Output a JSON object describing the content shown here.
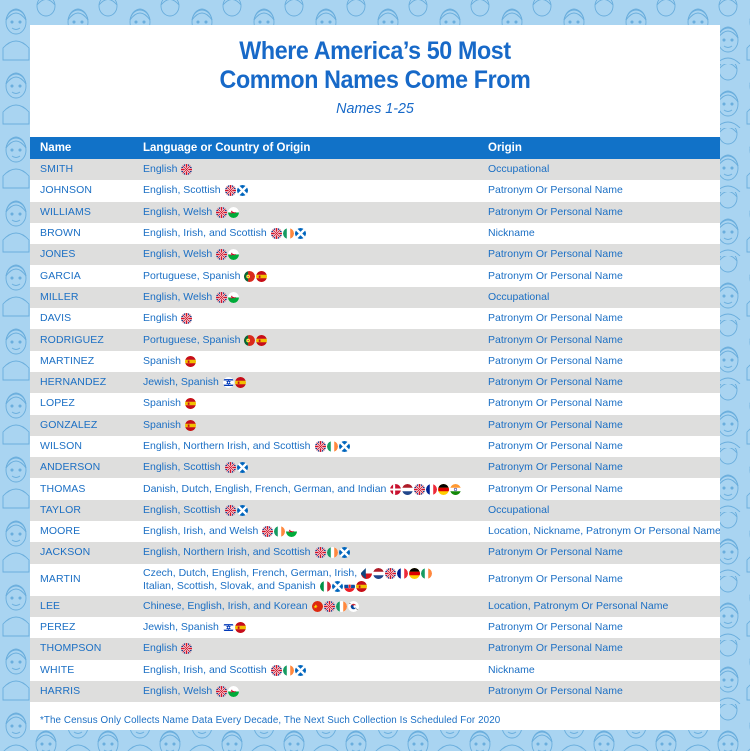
{
  "colors": {
    "brand_blue": "#1769c8",
    "header_blue": "#1172c8",
    "text_blue": "#1b6fc4",
    "row_alt": "#dededd",
    "background": "#a9d4f1",
    "card": "#ffffff"
  },
  "header": {
    "title_line_1": "Where America’s 50 Most",
    "title_line_2": "Common Names Come From",
    "subtitle": "Names 1-25"
  },
  "table": {
    "columns": [
      "Name",
      "Language or Country of Origin",
      "Origin"
    ],
    "rows": [
      {
        "name": "SMITH",
        "language": "English",
        "flags": [
          "gb"
        ],
        "origin": "Occupational"
      },
      {
        "name": "JOHNSON",
        "language": "English, Scottish",
        "flags": [
          "gb",
          "scotland"
        ],
        "origin": "Patronym Or Personal Name"
      },
      {
        "name": "WILLIAMS",
        "language": "English, Welsh",
        "flags": [
          "gb",
          "wales"
        ],
        "origin": "Patronym Or Personal Name"
      },
      {
        "name": "BROWN",
        "language": "English, Irish, and Scottish",
        "flags": [
          "gb",
          "ie",
          "scotland"
        ],
        "origin": "Nickname"
      },
      {
        "name": "JONES",
        "language": "English, Welsh",
        "flags": [
          "gb",
          "wales"
        ],
        "origin": "Patronym Or Personal Name"
      },
      {
        "name": "GARCIA",
        "language": "Portuguese, Spanish",
        "flags": [
          "pt",
          "es"
        ],
        "origin": "Patronym Or Personal Name"
      },
      {
        "name": "MILLER",
        "language": "English, Welsh",
        "flags": [
          "gb",
          "wales"
        ],
        "origin": "Occupational"
      },
      {
        "name": "DAVIS",
        "language": "English",
        "flags": [
          "gb"
        ],
        "origin": "Patronym Or Personal Name"
      },
      {
        "name": "RODRIGUEZ",
        "language": "Portuguese, Spanish",
        "flags": [
          "pt",
          "es"
        ],
        "origin": "Patronym Or Personal Name"
      },
      {
        "name": "MARTINEZ",
        "language": "Spanish",
        "flags": [
          "es"
        ],
        "origin": "Patronym Or Personal Name"
      },
      {
        "name": "HERNANDEZ",
        "language": "Jewish, Spanish",
        "flags": [
          "il",
          "es"
        ],
        "origin": "Patronym Or Personal Name"
      },
      {
        "name": "LOPEZ",
        "language": "Spanish",
        "flags": [
          "es"
        ],
        "origin": "Patronym Or Personal Name"
      },
      {
        "name": "GONZALEZ",
        "language": "Spanish",
        "flags": [
          "es"
        ],
        "origin": "Patronym Or Personal Name"
      },
      {
        "name": "WILSON",
        "language": "English, Northern Irish, and Scottish",
        "flags": [
          "gb",
          "ie",
          "scotland"
        ],
        "origin": "Patronym Or Personal Name"
      },
      {
        "name": "ANDERSON",
        "language": "English, Scottish",
        "flags": [
          "gb",
          "scotland"
        ],
        "origin": "Patronym Or Personal Name"
      },
      {
        "name": "THOMAS",
        "language": "Danish, Dutch, English, French, German, and Indian",
        "flags": [
          "dk",
          "nl",
          "gb",
          "fr",
          "de",
          "in"
        ],
        "origin": "Patronym Or Personal Name"
      },
      {
        "name": "TAYLOR",
        "language": "English, Scottish",
        "flags": [
          "gb",
          "scotland"
        ],
        "origin": "Occupational"
      },
      {
        "name": "MOORE",
        "language": "English, Irish, and Welsh",
        "flags": [
          "gb",
          "ie",
          "wales"
        ],
        "origin": "Location, Nickname, Patronym Or Personal Name"
      },
      {
        "name": "JACKSON",
        "language": "English, Northern Irish, and Scottish",
        "flags": [
          "gb",
          "ie",
          "scotland"
        ],
        "origin": "Patronym Or Personal Name"
      },
      {
        "name": "MARTIN",
        "language": "Czech, Dutch, English, French, German, Irish,",
        "flags": [
          "cz",
          "nl",
          "gb",
          "fr",
          "de",
          "ie"
        ],
        "language_2": "Italian, Scottish, Slovak, and Spanish",
        "flags_2": [
          "it",
          "scotland",
          "sk",
          "es"
        ],
        "origin": "Patronym Or Personal Name"
      },
      {
        "name": "LEE",
        "language": "Chinese, English, Irish, and Korean",
        "flags": [
          "cn",
          "gb",
          "ie",
          "kr"
        ],
        "origin": "Location, Patronym Or Personal Name"
      },
      {
        "name": "PEREZ",
        "language": "Jewish, Spanish",
        "flags": [
          "il",
          "es"
        ],
        "origin": "Patronym Or Personal Name"
      },
      {
        "name": "THOMPSON",
        "language": "English",
        "flags": [
          "gb"
        ],
        "origin": "Patronym Or Personal Name"
      },
      {
        "name": "WHITE",
        "language": "English, Irish, and Scottish",
        "flags": [
          "gb",
          "ie",
          "scotland"
        ],
        "origin": "Nickname"
      },
      {
        "name": "HARRIS",
        "language": "English, Welsh",
        "flags": [
          "gb",
          "wales"
        ],
        "origin": "Patronym Or Personal Name"
      }
    ]
  },
  "footnote": "*The Census Only Collects Name Data Every Decade, The Next Such Collection Is Scheduled For 2020",
  "flag_names": {
    "gb": "flag-united-kingdom-icon",
    "scotland": "flag-scotland-icon",
    "wales": "flag-wales-icon",
    "ie": "flag-ireland-icon",
    "es": "flag-spain-icon",
    "pt": "flag-portugal-icon",
    "il": "flag-israel-icon",
    "dk": "flag-denmark-icon",
    "nl": "flag-netherlands-icon",
    "fr": "flag-france-icon",
    "de": "flag-germany-icon",
    "in": "flag-india-icon",
    "cz": "flag-czech-republic-icon",
    "it": "flag-italy-icon",
    "sk": "flag-slovakia-icon",
    "cn": "flag-china-icon",
    "kr": "flag-south-korea-icon"
  }
}
